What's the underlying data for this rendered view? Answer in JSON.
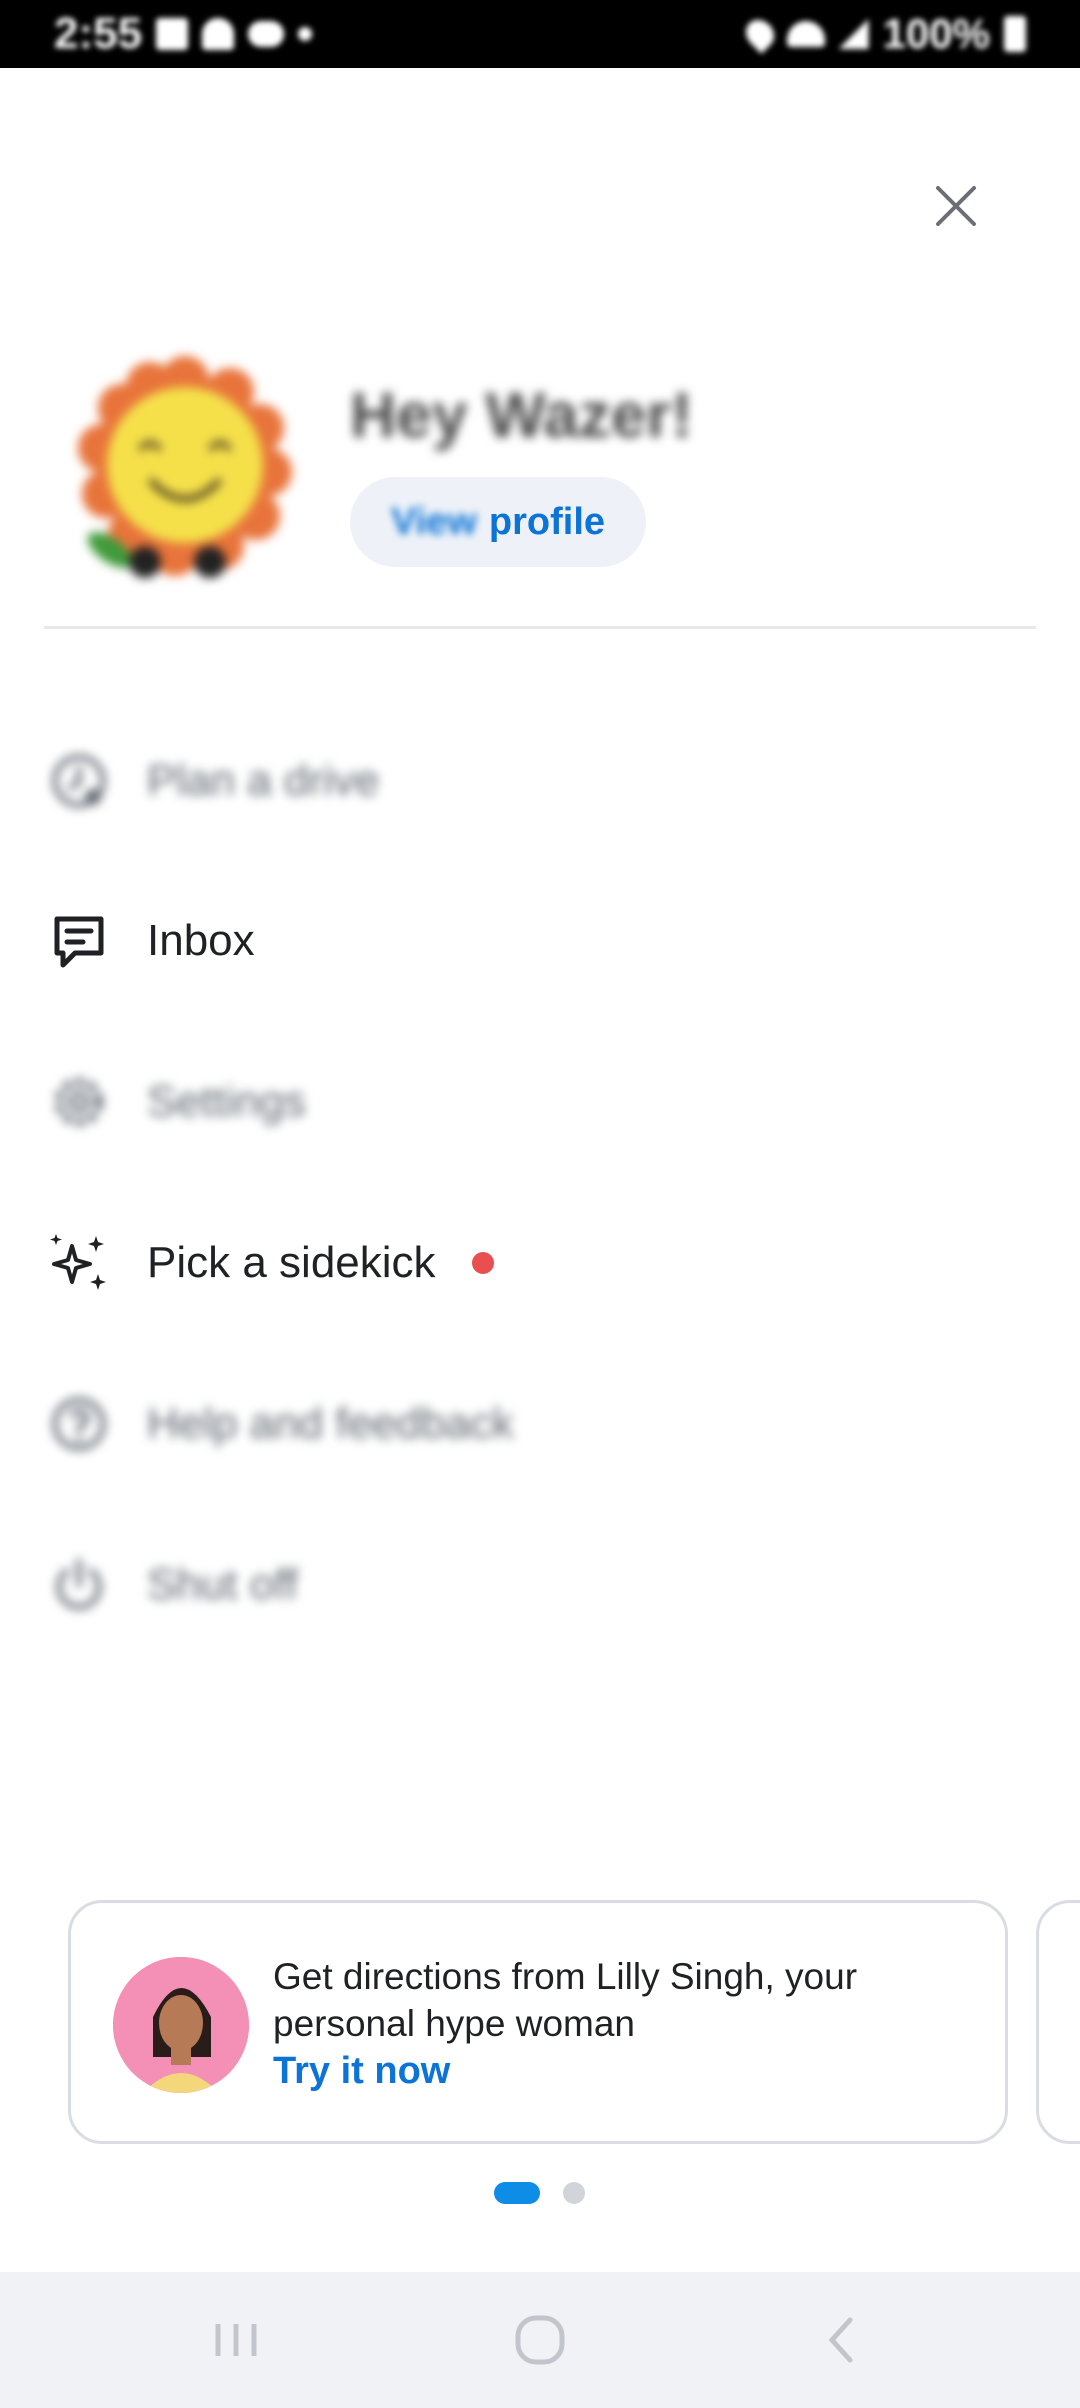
{
  "status_bar": {
    "time": "2:55",
    "battery": "100%"
  },
  "profile": {
    "greeting": "Hey Wazer!",
    "view_label": "View",
    "profile_label": "profile"
  },
  "menu": {
    "items": [
      {
        "label": "Plan a drive",
        "icon": "clock-pin-icon"
      },
      {
        "label": "Inbox",
        "icon": "inbox-icon"
      },
      {
        "label": "Settings",
        "icon": "gear-icon"
      },
      {
        "label": "Pick a sidekick",
        "icon": "sparkles-icon"
      },
      {
        "label": "Help and feedback",
        "icon": "question-icon"
      },
      {
        "label": "Shut off",
        "icon": "power-icon"
      }
    ]
  },
  "promo": {
    "text": "Get directions from Lilly Singh, your personal hype woman",
    "cta": "Try it now"
  },
  "pager": {
    "pages": 2,
    "active": 1
  },
  "colors": {
    "accent": "#0b74d6",
    "notification_dot": "#ea4e4e",
    "pager_active": "#0d8de6"
  }
}
